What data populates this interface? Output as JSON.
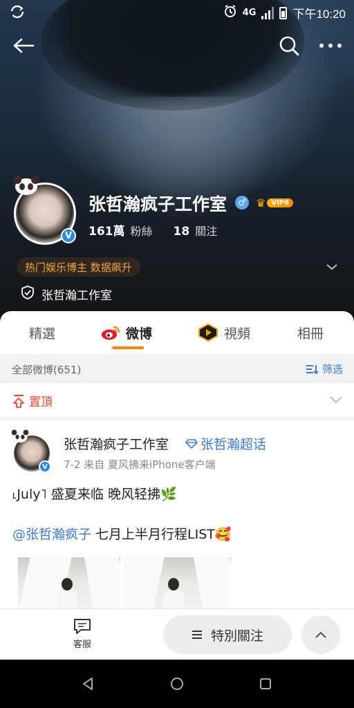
{
  "status_bar": {
    "network": "4G",
    "time": "下午10:20"
  },
  "profile": {
    "name": "张哲瀚疯子工作室",
    "vip_label": "VIP6",
    "followers_count": "161萬",
    "followers_label": "粉絲",
    "following_count": "18",
    "following_label": "關注",
    "tag": "热门娱乐博主 数据飙升",
    "org_name": "张哲瀚工作室"
  },
  "tabs": [
    {
      "label": "精選",
      "active": false
    },
    {
      "label": "微博",
      "active": true
    },
    {
      "label": "視頻",
      "active": false
    },
    {
      "label": "相冊",
      "active": false
    }
  ],
  "feed": {
    "count_text": "全部微博(651)",
    "filter_label": "筛选",
    "pinned_label": "置頂"
  },
  "post": {
    "author": "张哲瀚疯子工作室",
    "supertopic": "张哲瀚超话",
    "meta": "7-2   来自 夏风拂来iPhone客户端",
    "line1": "˪July˥ 盛夏来临 晚风轻拂🌿",
    "mention": "@张哲瀚疯子",
    "line2_rest": " 七月上半月行程LIST🥰"
  },
  "bottom_bar": {
    "service_label": "客服",
    "special_follow_label": "特別關注"
  },
  "colors": {
    "accent_orange": "#ff8200",
    "link_blue": "#3a7bd5",
    "pinned_red": "#e2492f",
    "tag_orange": "#f2a53a"
  }
}
